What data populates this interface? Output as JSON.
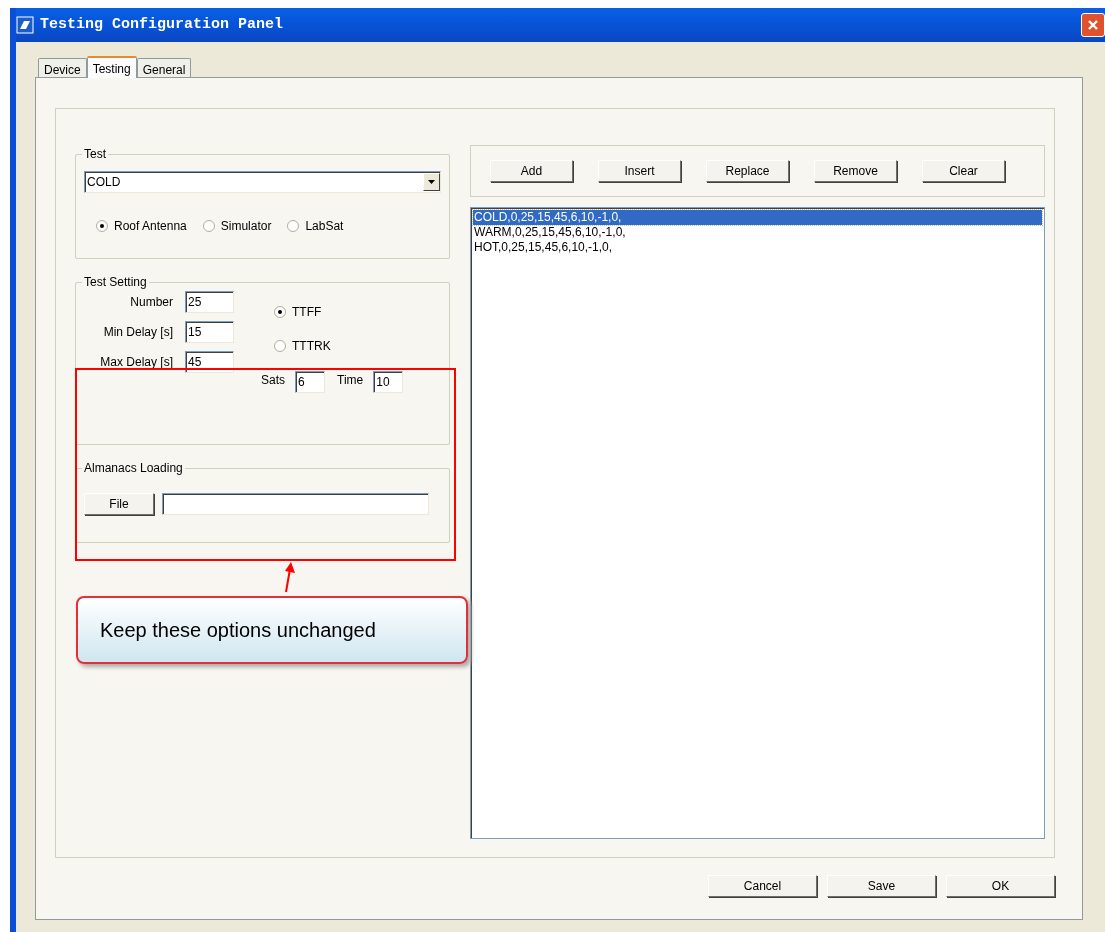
{
  "window": {
    "title": "Testing Configuration Panel"
  },
  "tabs": [
    {
      "label": "Device",
      "selected": false
    },
    {
      "label": "Testing",
      "selected": true
    },
    {
      "label": "General",
      "selected": false
    }
  ],
  "test_group": {
    "title": "Test",
    "dropdown": {
      "value": "COLD"
    },
    "sources": [
      {
        "label": "Roof Antenna",
        "selected": true
      },
      {
        "label": "Simulator",
        "selected": false
      },
      {
        "label": "LabSat",
        "selected": false
      }
    ]
  },
  "test_setting": {
    "title": "Test Setting",
    "fields": [
      {
        "label": "Number",
        "value": "25"
      },
      {
        "label": "Min Delay [s]",
        "value": "15"
      },
      {
        "label": "Max Delay [s]",
        "value": "45"
      }
    ],
    "modes": [
      {
        "label": "TTFF",
        "selected": true
      },
      {
        "label": "TTTRK",
        "selected": false
      }
    ],
    "sats": {
      "label": "Sats",
      "value": "6"
    },
    "time": {
      "label": "Time",
      "value": "10"
    }
  },
  "almanacs": {
    "title": "Almanacs Loading",
    "button": "File"
  },
  "list_buttons": [
    "Add",
    "Insert",
    "Replace",
    "Remove",
    "Clear"
  ],
  "list": [
    {
      "text": "COLD,0,25,15,45,6,10,-1,0,",
      "selected": true
    },
    {
      "text": "WARM,0,25,15,45,6,10,-1,0,",
      "selected": false
    },
    {
      "text": "HOT,0,25,15,45,6,10,-1,0,",
      "selected": false
    }
  ],
  "footer_buttons": [
    "Cancel",
    "Save",
    "OK"
  ],
  "annotation": {
    "text": "Keep these options unchanged"
  }
}
